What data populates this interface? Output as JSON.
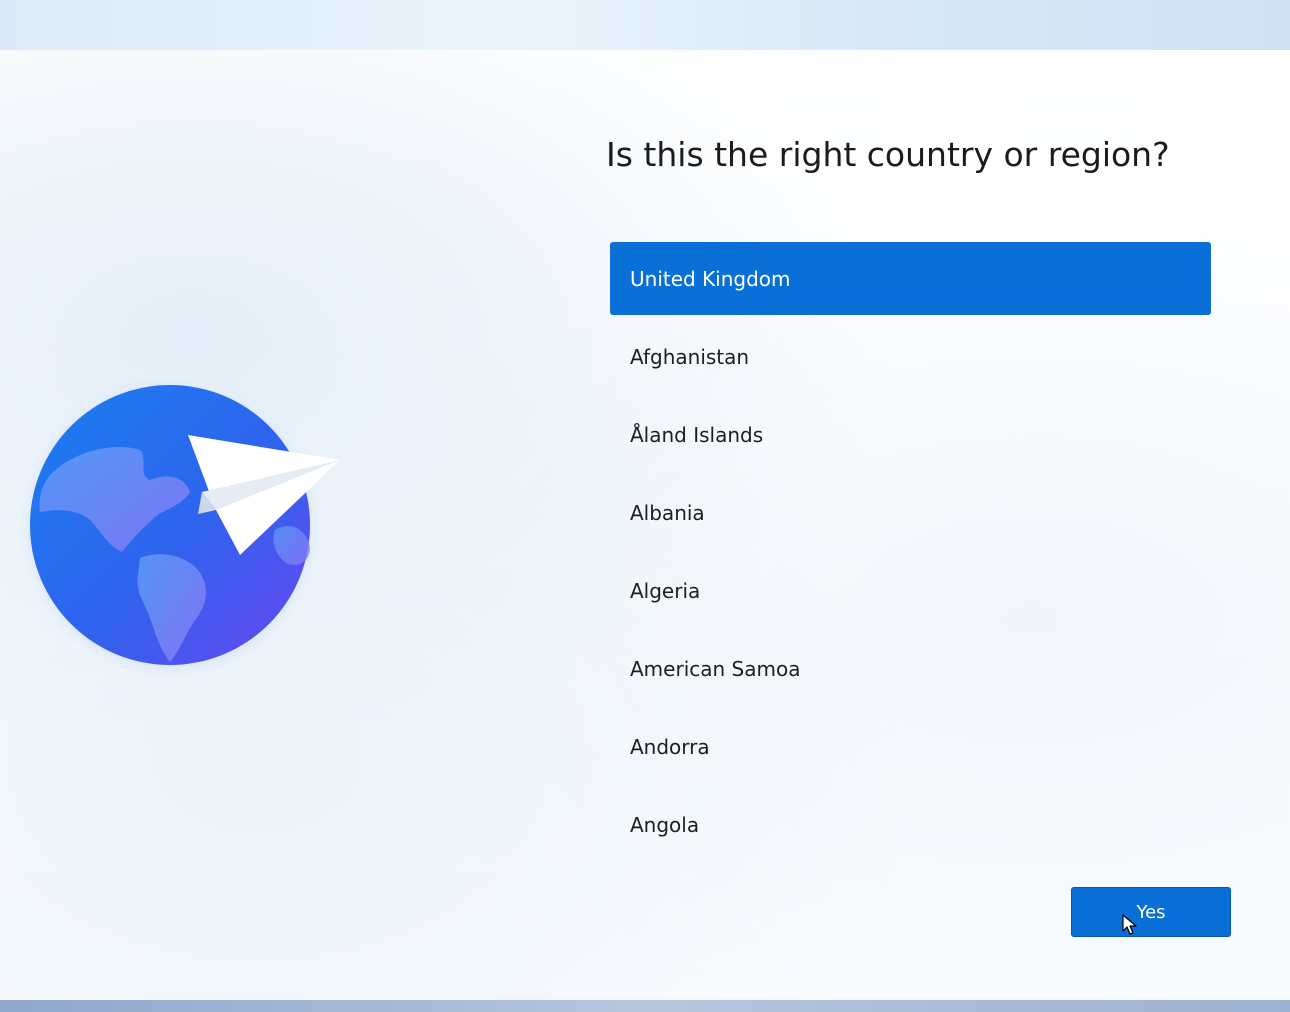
{
  "page": {
    "title": "Is this the right country or region?"
  },
  "countries": [
    {
      "label": "United Kingdom",
      "selected": true
    },
    {
      "label": "Afghanistan",
      "selected": false
    },
    {
      "label": "Åland Islands",
      "selected": false
    },
    {
      "label": "Albania",
      "selected": false
    },
    {
      "label": "Algeria",
      "selected": false
    },
    {
      "label": "American Samoa",
      "selected": false
    },
    {
      "label": "Andorra",
      "selected": false
    },
    {
      "label": "Angola",
      "selected": false
    }
  ],
  "actions": {
    "yes_label": "Yes"
  },
  "illustration": {
    "icon": "globe-paper-plane-icon"
  },
  "colors": {
    "accent": "#0a6fd6",
    "text": "#1e1e1e"
  }
}
